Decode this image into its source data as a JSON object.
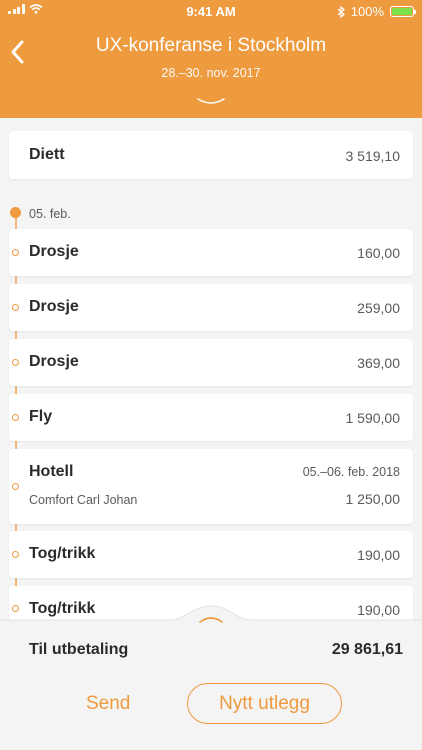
{
  "status_bar": {
    "time": "9:41 AM",
    "battery_text": "100%",
    "battery_color": "#7be04b"
  },
  "header": {
    "title": "UX-konferanse i Stockholm",
    "dates": "28.–30. nov. 2017",
    "accent_color": "#ee9a3e"
  },
  "summary": {
    "label": "Diett",
    "amount": "3 519,10"
  },
  "timeline": {
    "date": "05. feb.",
    "items": [
      {
        "label": "Drosje",
        "amount": "160,00"
      },
      {
        "label": "Drosje",
        "amount": "259,00"
      },
      {
        "label": "Drosje",
        "amount": "369,00"
      },
      {
        "label": "Fly",
        "amount": "1 590,00"
      },
      {
        "label": "Hotell",
        "date_range": "05.–06. feb. 2018",
        "sub": "Comfort Carl Johan",
        "amount": "1 250,00"
      },
      {
        "label": "Tog/trikk",
        "amount": "190,00"
      },
      {
        "label": "Tog/trikk",
        "amount": "190,00"
      }
    ]
  },
  "footer": {
    "payout_label": "Til utbetaling",
    "payout_amount": "29 861,61",
    "send_label": "Send",
    "new_expense_label": "Nytt utlegg"
  },
  "icons": {
    "back": "chevron-left-icon",
    "expand": "chevron-down-icon",
    "collapse": "chevron-up-icon"
  }
}
